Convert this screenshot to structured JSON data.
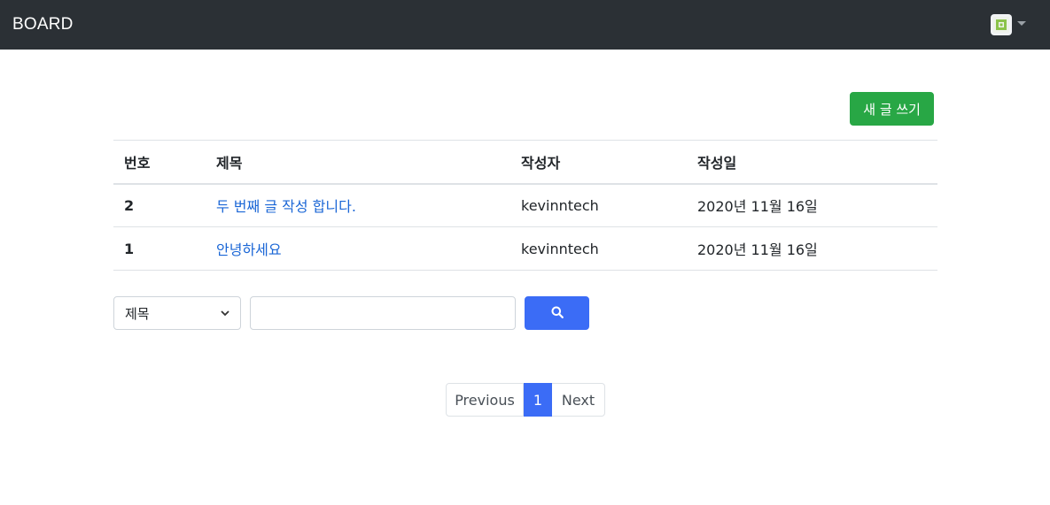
{
  "navbar": {
    "brand": "BOARD",
    "avatar_icon": "avatar-icon",
    "menu_icon": "caret-down-icon"
  },
  "toolbar": {
    "new_post_label": "새 글 쓰기",
    "new_post_color": "#28a745"
  },
  "table": {
    "headers": [
      "번호",
      "제목",
      "작성자",
      "작성일"
    ],
    "rows": [
      {
        "num": "2",
        "title": "두 번째 글 작성 합니다.",
        "writer": "kevinntech",
        "date": "2020년 11월 16일"
      },
      {
        "num": "1",
        "title": "안녕하세요",
        "writer": "kevinntech",
        "date": "2020년 11월 16일"
      }
    ]
  },
  "search": {
    "selected_option": "제목",
    "input_value": "",
    "button_icon": "search-icon",
    "button_color": "#3b6cf6"
  },
  "pagination": {
    "previous_label": "Previous",
    "current_page": "1",
    "next_label": "Next"
  }
}
